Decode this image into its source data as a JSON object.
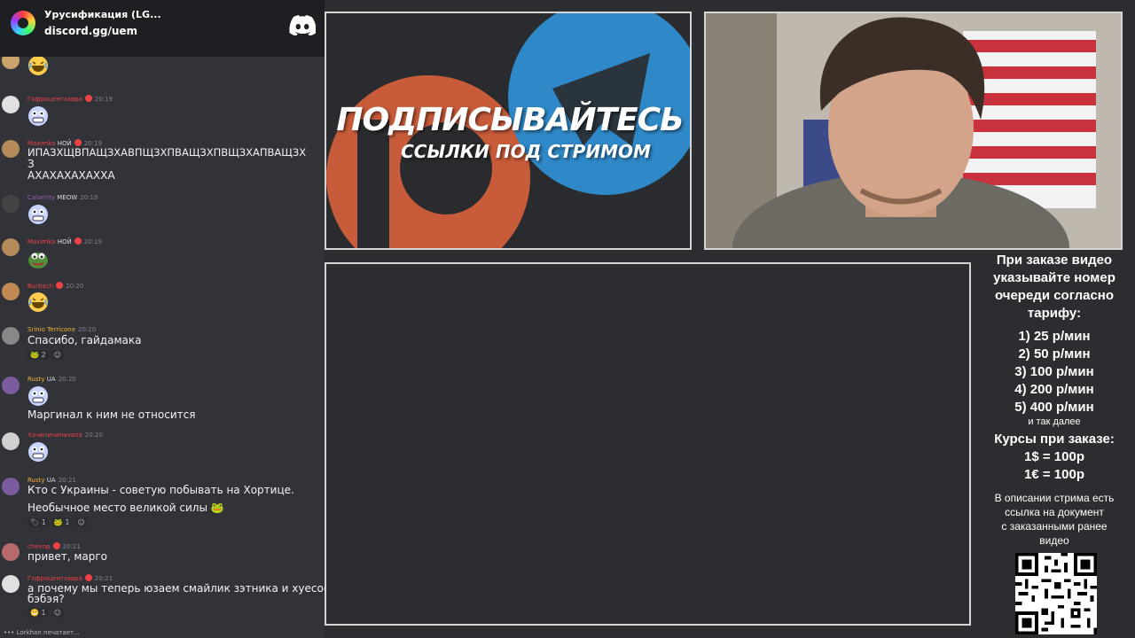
{
  "header": {
    "server_name": "Урусификация (LG...",
    "invite": "discord.gg/uem"
  },
  "chat": {
    "messages": [
      {
        "user": "Гофроцентзавра",
        "time": "20:19",
        "user_color": "#ed4245",
        "emoji": "face"
      },
      {
        "user": "Maximka",
        "tag": "НОЙ",
        "time": "20:19",
        "user_color": "#ed4245",
        "text1": "ИПАЗХЩВПАЩЗХАВПЩЗХПВАЩЗХПВЩЗХАПВАЩЗХ",
        "text2": "З",
        "text3": "АХАХАХАХАХХА"
      },
      {
        "user": "Calamity",
        "tag": "MEOW",
        "time": "20:19",
        "user_color": "#9b59b6",
        "emoji": "face"
      },
      {
        "user": "Maximka",
        "tag": "НОЙ",
        "time": "20:19",
        "user_color": "#ed4245",
        "emoji": "pepe"
      },
      {
        "user": "Burbach",
        "time": "20:20",
        "user_color": "#ed4245",
        "emoji": "laugh"
      },
      {
        "user": "Srinio Terricone",
        "time": "20:20",
        "user_color": "#f0b232",
        "text1": "Спасибо, гайдамака",
        "react_count": "2"
      },
      {
        "user": "Rusty",
        "tag": "UA",
        "time": "20:20",
        "user_color": "#f0b232",
        "emoji": "face",
        "text1": "Маргинал к ним не относится"
      },
      {
        "user": "Хачипичипачапа",
        "time": "20:20",
        "user_color": "#ed4245",
        "emoji": "face"
      },
      {
        "user": "Rusty",
        "tag": "UA",
        "time": "20:21",
        "user_color": "#f0b232",
        "text1": "Кто с Украины - советую побывать на Хортице.",
        "text2": "Необычное место великой силы",
        "react_count": "1",
        "react_count2": "1"
      },
      {
        "user": "chevnp",
        "time": "20:21",
        "user_color": "#ed4245",
        "text1": "привет, марго"
      },
      {
        "user": "Гофроцентзавра",
        "time": "20:21",
        "user_color": "#ed4245",
        "text1": "а почему мы теперь юзаем смайлик зэтника и хуесоса",
        "text2": "бэбэя?",
        "react_count": "1"
      }
    ],
    "typing": "Lorkhan печатает..."
  },
  "banner": {
    "title": "ПОДПИСЫВАЙТЕСЬ",
    "subtitle": "ССЫЛКИ ПОД СТРИМОМ"
  },
  "info": {
    "heading1": "При заказе видео",
    "heading2": "указывайте номер",
    "heading3": "очереди согласно",
    "heading4": "тарифу:",
    "tiers": [
      "1) 25 р/мин",
      "2) 50 р/мин",
      "3) 100 р/мин",
      "4) 200 р/мин",
      "5) 400 р/мин"
    ],
    "etc": "и так далее",
    "rates_title": "Курсы при заказе:",
    "rate_usd": "1$ = 100р",
    "rate_eur": "1€ = 100р",
    "desc1": "В описании стрима есть",
    "desc2": "ссылка на документ",
    "desc3": "с заказанными ранее",
    "desc4": "видео"
  }
}
